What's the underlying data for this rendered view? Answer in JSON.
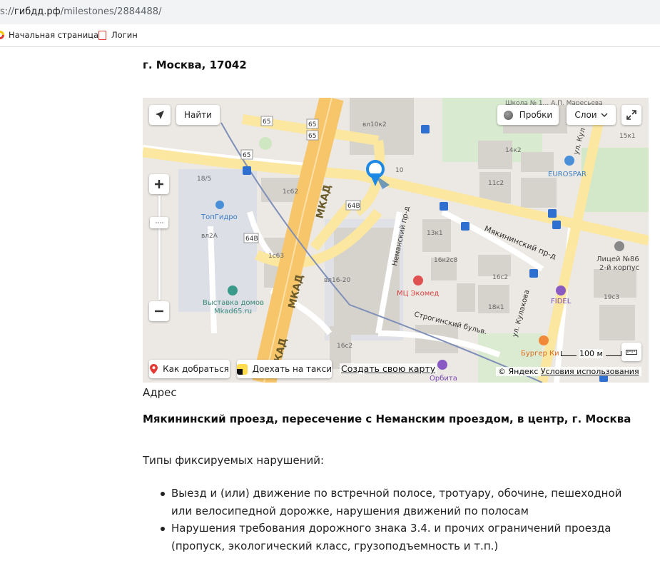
{
  "browser": {
    "url_prefix": "s://",
    "url_domain": "гибдд.рф",
    "url_path": "/milestones/2884488/",
    "bookmarks": [
      {
        "label": "Начальная страница",
        "icon": "yandex-browser-icon"
      },
      {
        "label": "Логин",
        "icon": "document-icon"
      }
    ]
  },
  "page": {
    "title": "г. Москва, 17042",
    "address_label": "Адрес",
    "address": "Мякининский проезд, пересечение с Неманским проездом, в центр, г. Москва",
    "types_title": "Типы фиксируемых нарушений:",
    "violations": [
      "Выезд и (или) движение по встречной полосе, тротуару, обочине, пешеходной или велосипедной дорожке, нарушения движений по полосам",
      "Нарушения требования дорожного знака 3.4. и прочих ограничений проезда (пропуск, экологический класс, грузоподъемность и т.п.)"
    ]
  },
  "map": {
    "controls": {
      "find": "Найти",
      "traffic": "Пробки",
      "layers": "Слои",
      "route": "Как добраться",
      "taxi": "Доехать на такси",
      "create_map": "Создать свою карту",
      "copyright": "© Яндекс",
      "terms": "Условия использования",
      "scale": "100 м"
    },
    "labels": {
      "mkad": "МКАД",
      "road_65": "65",
      "road_64b": "64В",
      "myakininsky": "Мякининский пр-д",
      "nemansky": "Неманский пр-д",
      "kulakova": "ул. Кулакова",
      "kulakova_top": "ул. Кул",
      "stroginsky": "Строгинский бульв.",
      "topgidro": "ТопГидро",
      "vystavka": "Выставка домов",
      "vystavka2": "Mkad65.ru",
      "mc_ekomed": "МЦ Экомед",
      "eurospar": "EUROSPAR",
      "fidel": "FIDEL",
      "burger": "Бургер Ки",
      "orbita": "Орбита",
      "litsey": "Лицей №86",
      "litsey2": "2-й корпус",
      "vl10k2": "вл10к2",
      "n10": "10",
      "n14k2": "14к2",
      "n11c2": "11с2",
      "n13k1": "13к1",
      "n16k2c8": "16к2с8",
      "n16c2": "16с2",
      "n18k1": "18к1",
      "n19c3": "19с3",
      "n15k1": "15к1",
      "n1c62": "1с62",
      "n1c63": "1с63",
      "vl2a": "вл2А",
      "n18_5": "18/5",
      "vl16_20": "вл16-20",
      "n16c2b": "16с2",
      "school": "Школа № 1... А.П. Маресьева"
    },
    "colors": {
      "mkad": "#f7c56a",
      "road": "#fff3c4",
      "building": "#d9d6d0",
      "green": "#cfe6c2",
      "marker": "#1e88e5",
      "route_line": "#7f8fb8"
    }
  }
}
